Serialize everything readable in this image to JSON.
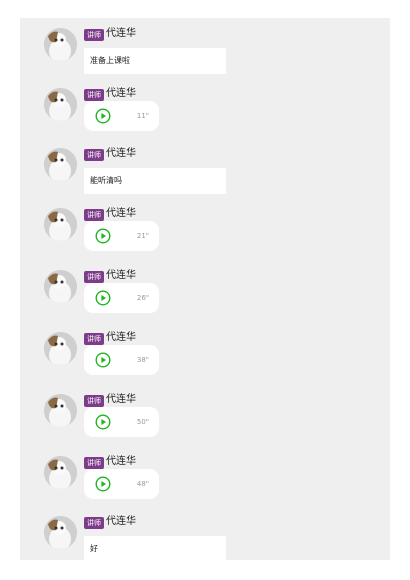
{
  "messages": [
    {
      "role_tag": "讲师",
      "sender": "代连华",
      "type": "text",
      "text": "准备上课啦"
    },
    {
      "role_tag": "讲师",
      "sender": "代连华",
      "type": "voice",
      "duration": "11\""
    },
    {
      "role_tag": "讲师",
      "sender": "代连华",
      "type": "text",
      "text": "能听清吗"
    },
    {
      "role_tag": "讲师",
      "sender": "代连华",
      "type": "voice",
      "duration": "21\""
    },
    {
      "role_tag": "讲师",
      "sender": "代连华",
      "type": "voice",
      "duration": "26\""
    },
    {
      "role_tag": "讲师",
      "sender": "代连华",
      "type": "voice",
      "duration": "38\""
    },
    {
      "role_tag": "讲师",
      "sender": "代连华",
      "type": "voice",
      "duration": "50\""
    },
    {
      "role_tag": "讲师",
      "sender": "代连华",
      "type": "voice",
      "duration": "48\""
    },
    {
      "role_tag": "讲师",
      "sender": "代连华",
      "type": "text",
      "text": "好"
    }
  ],
  "colors": {
    "tag_bg": "#7d3c8a",
    "play_icon": "#1fb51f",
    "panel_bg": "#efefef"
  },
  "icons": {
    "play": "play-circle-icon"
  }
}
